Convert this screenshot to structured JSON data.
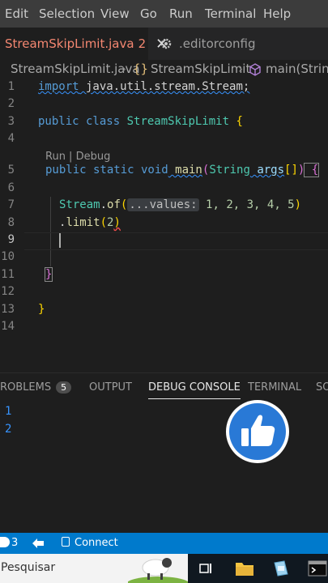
{
  "menu": [
    "Edit",
    "Selection",
    "View",
    "Go",
    "Run",
    "Terminal",
    "Help"
  ],
  "tabs": {
    "active": {
      "label": "StreamSkipLimit.java",
      "problems": "2"
    },
    "inactive": {
      "label": ".editorconfig"
    }
  },
  "breadcrumb": {
    "file": "StreamSkipLimit.java",
    "class": "StreamSkipLimit",
    "method": "main(String"
  },
  "editor": {
    "line_numbers": [
      "1",
      "2",
      "3",
      "4",
      "5",
      "6",
      "7",
      "8",
      "9",
      "10",
      "11",
      "12",
      "13",
      "14"
    ],
    "codelens": "Run | Debug",
    "lines": {
      "l1_kw": "import",
      "l1_rest": " java.util.stream.Stream;",
      "l3_kw": "public class",
      "l3_cls": " StreamSkipLimit",
      "l3_brace": " {",
      "l5_kw1": "public static void",
      "l5_fn": " main",
      "l5_p": "(",
      "l5_type": "String",
      "l5_var": " args",
      "l5_arr": "[]",
      "l5_close": ")",
      "l5_brace": " {",
      "l7_cls": "Stream",
      "l7_dot": ".",
      "l7_fn": "of",
      "l7_open": "(",
      "l7_hint": "...values:",
      "l7_nums": " 1, 2, 3, 4, 5",
      "l7_close": ")",
      "l8_dot": ".",
      "l8_fn": "limit",
      "l8_open": "(",
      "l8_num": "2",
      "l8_close": ")",
      "l11_brace": "}",
      "l13_brace": "}"
    }
  },
  "panel": {
    "tabs": [
      "ROBLEMS",
      "OUTPUT",
      "DEBUG CONSOLE",
      "TERMINAL",
      "SO"
    ],
    "problems_count": "5",
    "active_tab": "DEBUG CONSOLE",
    "output": [
      "1",
      "2"
    ]
  },
  "statusbar": {
    "errors": "3",
    "connect": "Connect"
  },
  "taskbar": {
    "search_placeholder": "Pesquisar"
  },
  "colors": {
    "accent": "#007acc",
    "like_button": "#2979d6"
  },
  "icons": [
    "gear-icon",
    "cube-icon",
    "thumbs-up-icon",
    "remote-icon",
    "error-icon",
    "folder-icon",
    "terminal-icon"
  ]
}
